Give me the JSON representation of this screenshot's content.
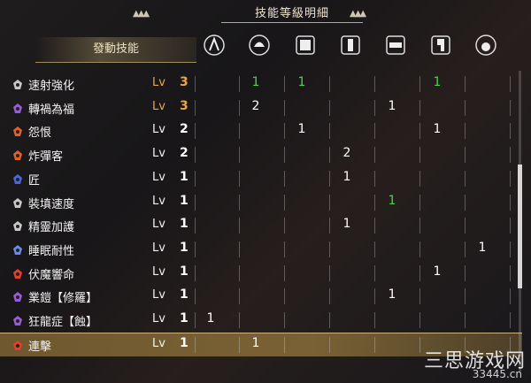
{
  "title": "技能等級明細",
  "column_header": "發動技能",
  "equipment_icons": [
    "weapon-icon",
    "helmet-icon",
    "chest-icon",
    "arms-icon",
    "waist-icon",
    "legs-icon",
    "talisman-icon"
  ],
  "colors": {
    "orange": "#e8a64a",
    "green": "#4ed24e",
    "white": "#ffffff"
  },
  "rows": [
    {
      "name": "速射強化",
      "lv": "Lv",
      "level": "3",
      "level_color": "orange",
      "icon_color": "#c8c8c8",
      "cells": [
        "",
        "1",
        "1",
        "",
        "",
        "1",
        ""
      ],
      "cell_colors": [
        "",
        "green",
        "green",
        "",
        "",
        "green",
        ""
      ]
    },
    {
      "name": "轉禍為福",
      "lv": "Lv",
      "level": "3",
      "level_color": "orange",
      "icon_color": "#9b5ad6",
      "cells": [
        "",
        "2",
        "",
        "",
        "1",
        "",
        ""
      ],
      "cell_colors": [
        "",
        "white",
        "",
        "",
        "white",
        "",
        ""
      ]
    },
    {
      "name": "怨恨",
      "lv": "Lv",
      "level": "2",
      "level_color": "white",
      "icon_color": "#e0602a",
      "cells": [
        "",
        "",
        "1",
        "",
        "",
        "1",
        ""
      ],
      "cell_colors": [
        "",
        "",
        "white",
        "",
        "",
        "white",
        ""
      ]
    },
    {
      "name": "炸彈客",
      "lv": "Lv",
      "level": "2",
      "level_color": "white",
      "icon_color": "#e0602a",
      "cells": [
        "",
        "",
        "",
        "2",
        "",
        "",
        ""
      ],
      "cell_colors": [
        "",
        "",
        "",
        "white",
        "",
        "",
        ""
      ]
    },
    {
      "name": "匠",
      "lv": "Lv",
      "level": "1",
      "level_color": "white",
      "icon_color": "#4a66e0",
      "cells": [
        "",
        "",
        "",
        "1",
        "",
        "",
        ""
      ],
      "cell_colors": [
        "",
        "",
        "",
        "white",
        "",
        "",
        ""
      ]
    },
    {
      "name": "裝填速度",
      "lv": "Lv",
      "level": "1",
      "level_color": "white",
      "icon_color": "#c8c8c8",
      "cells": [
        "",
        "",
        "",
        "",
        "1",
        "",
        ""
      ],
      "cell_colors": [
        "",
        "",
        "",
        "",
        "green",
        "",
        ""
      ]
    },
    {
      "name": "精靈加護",
      "lv": "Lv",
      "level": "1",
      "level_color": "white",
      "icon_color": "#c8c8c8",
      "cells": [
        "",
        "",
        "",
        "1",
        "",
        "",
        ""
      ],
      "cell_colors": [
        "",
        "",
        "",
        "white",
        "",
        "",
        ""
      ]
    },
    {
      "name": "睡眠耐性",
      "lv": "Lv",
      "level": "1",
      "level_color": "white",
      "icon_color": "#6a8ae8",
      "cells": [
        "",
        "",
        "",
        "",
        "",
        "",
        "1"
      ],
      "cell_colors": [
        "",
        "",
        "",
        "",
        "",
        "",
        "white"
      ]
    },
    {
      "name": "伏魔響命",
      "lv": "Lv",
      "level": "1",
      "level_color": "white",
      "icon_color": "#e0402a",
      "cells": [
        "",
        "",
        "",
        "",
        "",
        "1",
        ""
      ],
      "cell_colors": [
        "",
        "",
        "",
        "",
        "",
        "white",
        ""
      ]
    },
    {
      "name": "業鎧【修羅】",
      "lv": "Lv",
      "level": "1",
      "level_color": "white",
      "icon_color": "#9b5ad6",
      "cells": [
        "",
        "",
        "",
        "",
        "1",
        "",
        ""
      ],
      "cell_colors": [
        "",
        "",
        "",
        "",
        "white",
        "",
        ""
      ]
    },
    {
      "name": "狂龍症【蝕】",
      "lv": "Lv",
      "level": "1",
      "level_color": "white",
      "icon_color": "#9b5ad6",
      "cells": [
        "1",
        "",
        "",
        "",
        "",
        "",
        ""
      ],
      "cell_colors": [
        "white",
        "",
        "",
        "",
        "",
        "",
        ""
      ]
    },
    {
      "name": "連擊",
      "lv": "Lv",
      "level": "1",
      "level_color": "white",
      "icon_color": "#e0402a",
      "cells": [
        "",
        "1",
        "",
        "",
        "",
        "",
        ""
      ],
      "cell_colors": [
        "",
        "white",
        "",
        "",
        "",
        "",
        ""
      ]
    }
  ],
  "watermark": {
    "main": "三思游戏网",
    "sub": "33445.cn"
  }
}
